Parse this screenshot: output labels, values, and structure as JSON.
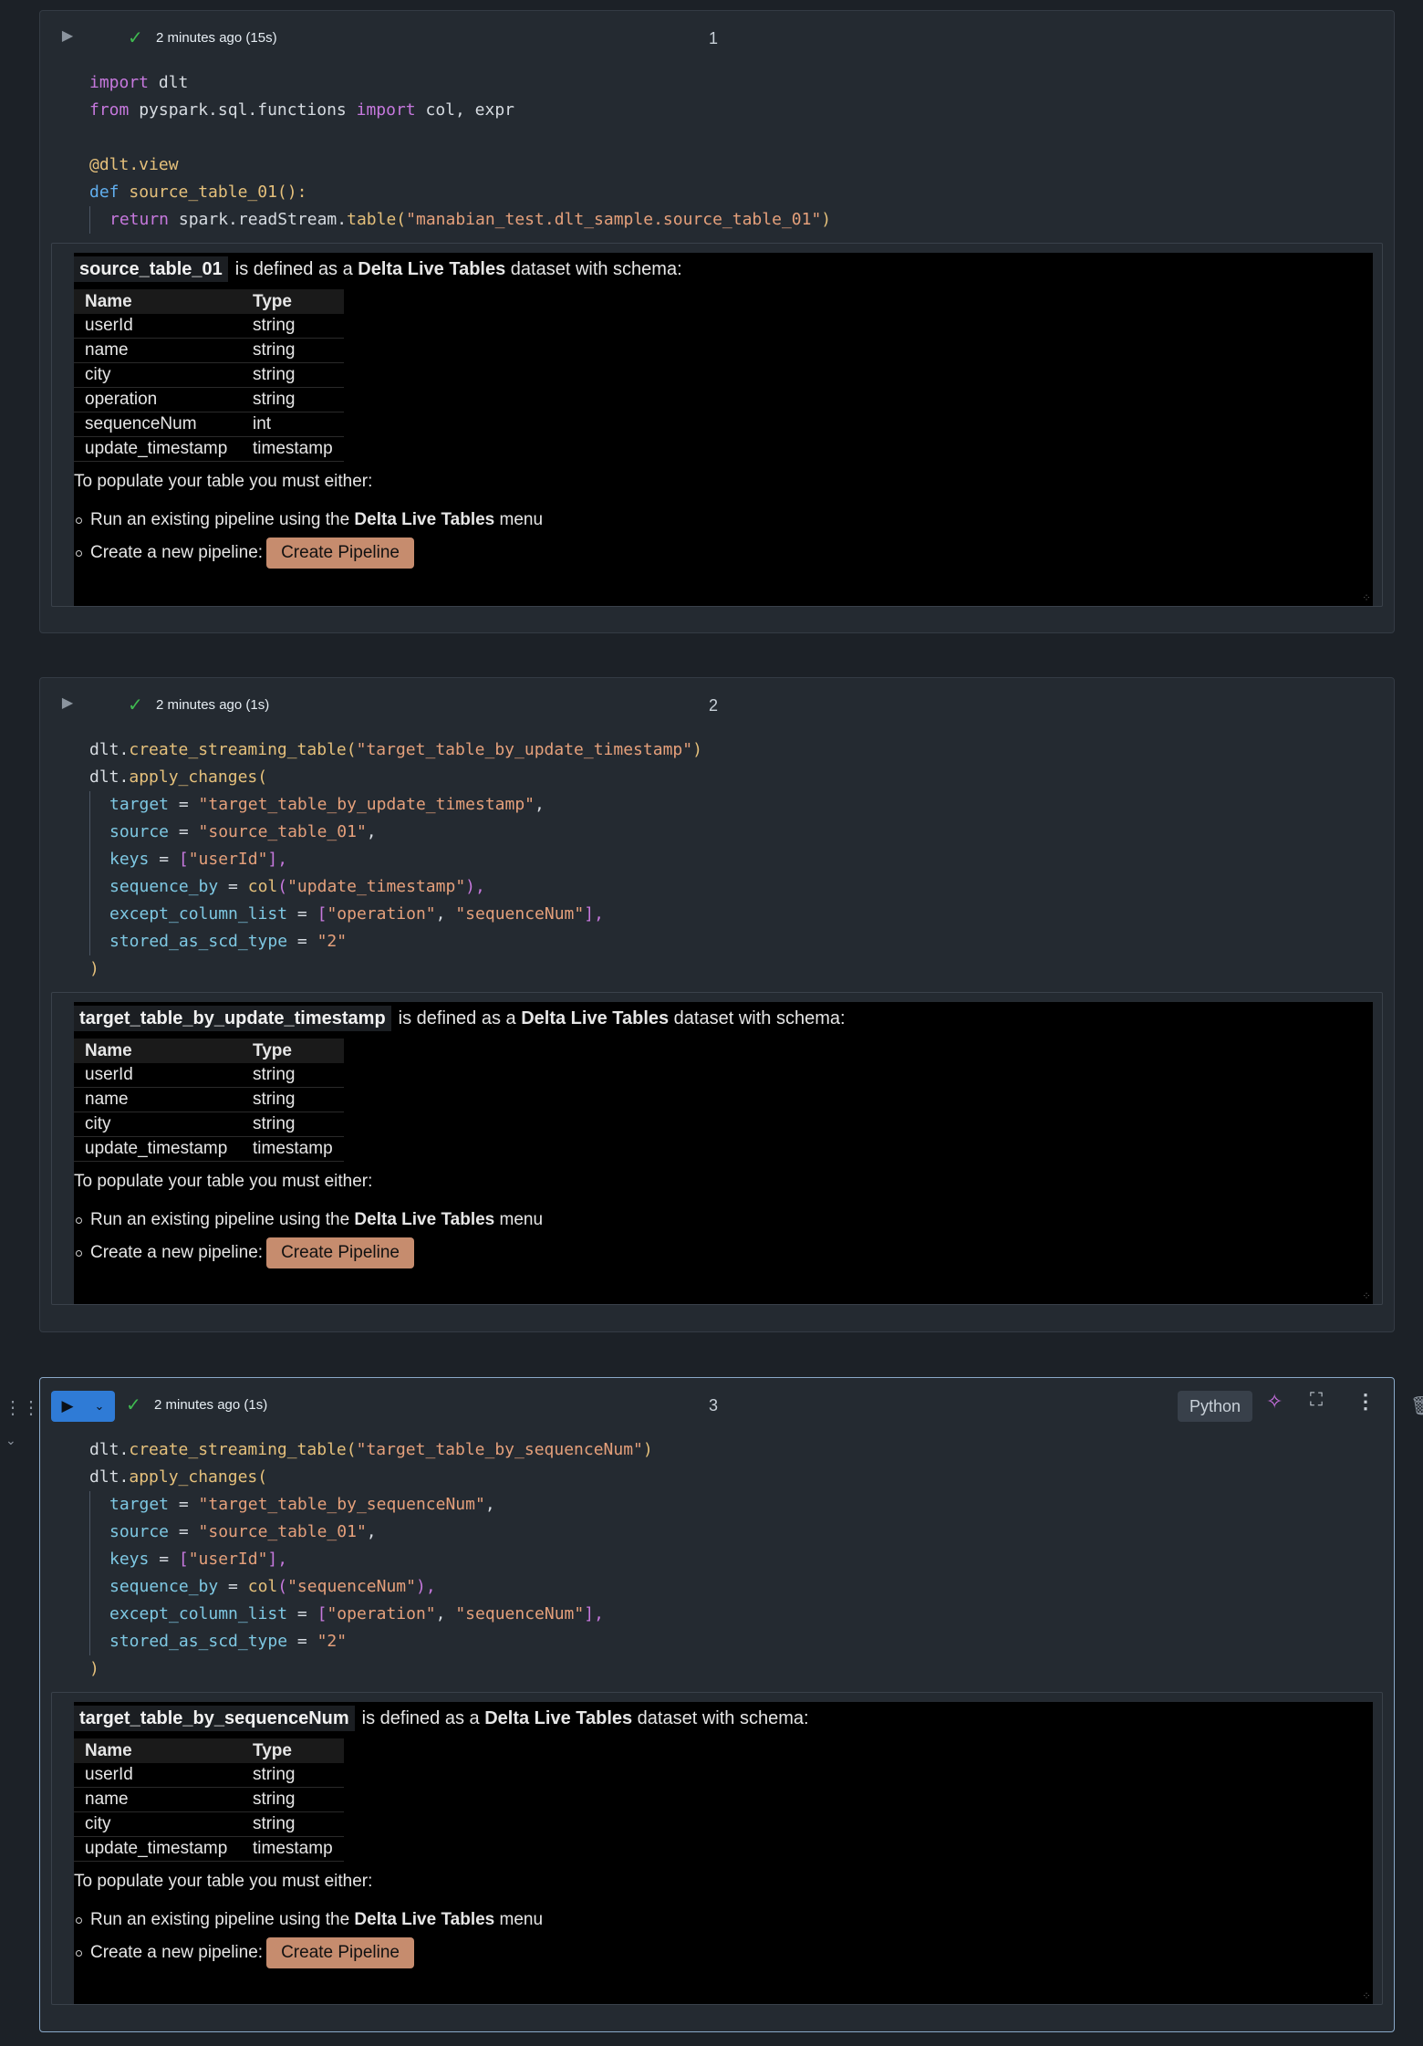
{
  "cells": [
    {
      "status": "2 minutes ago (15s)",
      "number": "1",
      "code": {
        "l1a": "import",
        "l1b": " dlt",
        "l2a": "from",
        "l2b": " pyspark.sql.functions ",
        "l2c": "import",
        "l2d": " col, expr",
        "l4": "@dlt.view",
        "l5a": "def",
        "l5b": " ",
        "l5c": "source_table_01",
        "l5d": "():",
        "l6a": "return",
        "l6b": " spark.readStream.",
        "l6c": "table",
        "l6d": "(",
        "l6e": "\"manabian_test.dlt_sample.source_table_01\"",
        "l6f": ")"
      },
      "output": {
        "table_name": "source_table_01",
        "defined_prefix": "is defined as a ",
        "dlt_bold": "Delta Live Tables",
        "defined_suffix": " dataset with schema:",
        "columns": {
          "name": "Name",
          "type": "Type"
        },
        "rows": [
          {
            "name": "userId",
            "type": "string"
          },
          {
            "name": "name",
            "type": "string"
          },
          {
            "name": "city",
            "type": "string"
          },
          {
            "name": "operation",
            "type": "string"
          },
          {
            "name": "sequenceNum",
            "type": "int"
          },
          {
            "name": "update_timestamp",
            "type": "timestamp"
          }
        ],
        "populate": "To populate your table you must either:",
        "opt1_prefix": "Run an existing pipeline using the ",
        "opt1_bold": "Delta Live Tables",
        "opt1_suffix": " menu",
        "opt2_prefix": "Create a new pipeline:",
        "create_button": "Create Pipeline"
      }
    },
    {
      "status": "2 minutes ago (1s)",
      "number": "2",
      "code": {
        "a1": "dlt.",
        "a2": "create_streaming_table",
        "a3": "(",
        "a4": "\"target_table_by_update_timestamp\"",
        "a5": ")",
        "b1": "dlt.",
        "b2": "apply_changes",
        "b3": "(",
        "c1": "target",
        "c2": " = ",
        "c3": "\"target_table_by_update_timestamp\"",
        "c4": ",",
        "d1": "source",
        "d2": " = ",
        "d3": "\"source_table_01\"",
        "d4": ",",
        "e1": "keys",
        "e2": " = ",
        "e3": "[",
        "e4": "\"userId\"",
        "e5": "],",
        "f1": "sequence_by",
        "f2": " = ",
        "f3": "col",
        "f4": "(",
        "f5": "\"update_timestamp\"",
        "f6": "),",
        "g1": "except_column_list",
        "g2": " = ",
        "g3": "[",
        "g4": "\"operation\"",
        "g5": ", ",
        "g6": "\"sequenceNum\"",
        "g7": "],",
        "h1": "stored_as_scd_type",
        "h2": " = ",
        "h3": "\"2\"",
        "i1": ")"
      },
      "output": {
        "table_name": "target_table_by_update_timestamp",
        "defined_prefix": "is defined as a ",
        "dlt_bold": "Delta Live Tables",
        "defined_suffix": " dataset with schema:",
        "columns": {
          "name": "Name",
          "type": "Type"
        },
        "rows": [
          {
            "name": "userId",
            "type": "string"
          },
          {
            "name": "name",
            "type": "string"
          },
          {
            "name": "city",
            "type": "string"
          },
          {
            "name": "update_timestamp",
            "type": "timestamp"
          }
        ],
        "populate": "To populate your table you must either:",
        "opt1_prefix": "Run an existing pipeline using the ",
        "opt1_bold": "Delta Live Tables",
        "opt1_suffix": " menu",
        "opt2_prefix": "Create a new pipeline:",
        "create_button": "Create Pipeline"
      }
    },
    {
      "status": "2 minutes ago (1s)",
      "number": "3",
      "language": "Python",
      "code": {
        "a1": "dlt.",
        "a2": "create_streaming_table",
        "a3": "(",
        "a4": "\"target_table_by_sequenceNum\"",
        "a5": ")",
        "b1": "dlt.",
        "b2": "apply_changes",
        "b3": "(",
        "c1": "target",
        "c2": " = ",
        "c3": "\"target_table_by_sequenceNum\"",
        "c4": ",",
        "d1": "source",
        "d2": " = ",
        "d3": "\"source_table_01\"",
        "d4": ",",
        "e1": "keys",
        "e2": " = ",
        "e3": "[",
        "e4": "\"userId\"",
        "e5": "],",
        "f1": "sequence_by",
        "f2": " = ",
        "f3": "col",
        "f4": "(",
        "f5": "\"sequenceNum\"",
        "f6": "),",
        "g1": "except_column_list",
        "g2": " = ",
        "g3": "[",
        "g4": "\"operation\"",
        "g5": ", ",
        "g6": "\"sequenceNum\"",
        "g7": "],",
        "h1": "stored_as_scd_type",
        "h2": " = ",
        "h3": "\"2\"",
        "i1": ")"
      },
      "output": {
        "table_name": "target_table_by_sequenceNum",
        "defined_prefix": "is defined as a ",
        "dlt_bold": "Delta Live Tables",
        "defined_suffix": " dataset with schema:",
        "columns": {
          "name": "Name",
          "type": "Type"
        },
        "rows": [
          {
            "name": "userId",
            "type": "string"
          },
          {
            "name": "name",
            "type": "string"
          },
          {
            "name": "city",
            "type": "string"
          },
          {
            "name": "update_timestamp",
            "type": "timestamp"
          }
        ],
        "populate": "To populate your table you must either:",
        "opt1_prefix": "Run an existing pipeline using the ",
        "opt1_bold": "Delta Live Tables",
        "opt1_suffix": " menu",
        "opt2_prefix": "Create a new pipeline:",
        "create_button": "Create Pipeline"
      }
    }
  ],
  "icons": {
    "run": "play-icon",
    "status": "check-icon",
    "assistant": "sparkle-icon",
    "expand": "fullscreen-icon",
    "more": "kebab-menu-icon",
    "drag": "drag-handle-icon",
    "delete": "trash-icon"
  },
  "colors": {
    "background": "#1c2127",
    "cell": "#242a31",
    "run_button": "#2f7bd6",
    "check": "#3fb950",
    "create_button": "#c68c6e"
  }
}
